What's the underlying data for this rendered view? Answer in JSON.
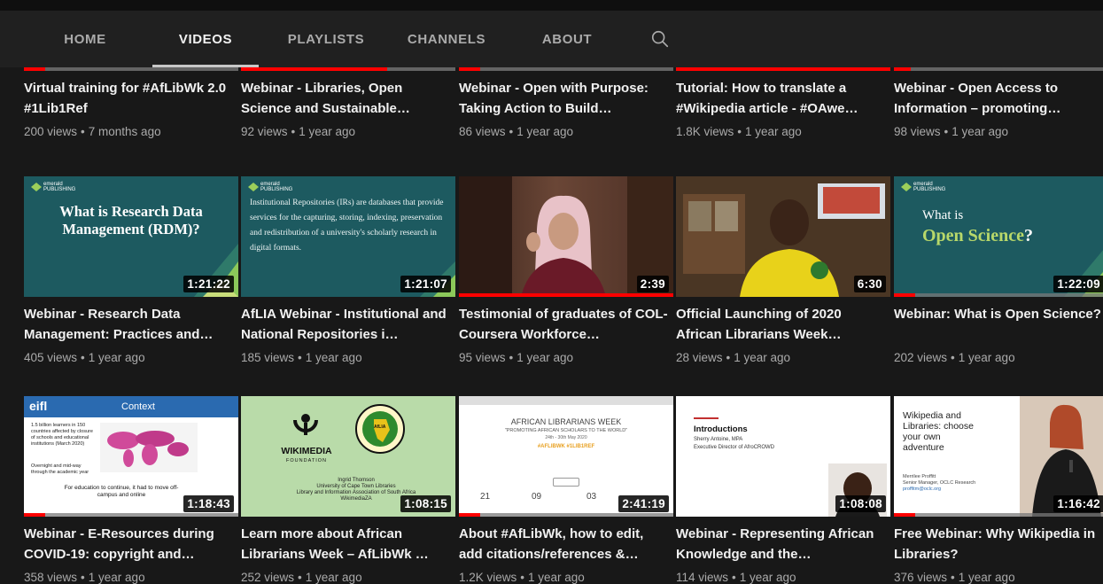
{
  "tabs": [
    {
      "label": "HOME"
    },
    {
      "label": "VIDEOS"
    },
    {
      "label": "PLAYLISTS"
    },
    {
      "label": "CHANNELS"
    },
    {
      "label": "ABOUT"
    }
  ],
  "search_icon": "search-icon",
  "colors": {
    "background": "#181818",
    "tab_bar": "#202020",
    "progress": "#ff0000",
    "emerald_teal": "#1d5a60"
  },
  "videos": [
    {
      "title": "Virtual training for #AfLibWk 2.0 #1Lib1Ref",
      "views": "200 views",
      "age": "7 months ago",
      "progress": 0.1
    },
    {
      "title": "Webinar - Libraries, Open Science and Sustainable…",
      "views": "92 views",
      "age": "1 year ago",
      "progress": 0.68
    },
    {
      "title": "Webinar - Open with Purpose: Taking Action to Build…",
      "views": "86 views",
      "age": "1 year ago",
      "progress": 0.1
    },
    {
      "title": "Tutorial: How to translate a #Wikipedia article - #OAwe…",
      "views": "1.8K views",
      "age": "1 year ago",
      "progress": 1.0
    },
    {
      "title": "Webinar - Open Access to Information – promoting…",
      "views": "98 views",
      "age": "1 year ago",
      "progress": 0.08
    },
    {
      "title": "Webinar - Research Data Management: Practices and…",
      "views": "405 views",
      "age": "1 year ago",
      "duration": "1:21:22",
      "progress": 0.0,
      "thumb": {
        "logo": "emerald PUBLISHING",
        "headline": "What is Research Data Management (RDM)?"
      }
    },
    {
      "title": "AfLIA Webinar - Institutional and National Repositories i…",
      "views": "185 views",
      "age": "1 year ago",
      "duration": "1:21:07",
      "progress": 0.0,
      "thumb": {
        "logo": "emerald PUBLISHING",
        "text": "Institutional Repositories (IRs) are databases that provide services for the capturing, storing, indexing, preservation and redistribution of a university's scholarly research in digital formats."
      }
    },
    {
      "title": "Testimonial of graduates of COL-Coursera Workforce…",
      "views": "95 views",
      "age": "1 year ago",
      "duration": "2:39",
      "progress": 1.0
    },
    {
      "title": "Official Launching of 2020 African Librarians Week…",
      "views": "28 views",
      "age": "1 year ago",
      "duration": "6:30",
      "progress": 0.0
    },
    {
      "title": "Webinar: What is Open Science?",
      "views": "202 views",
      "age": "1 year ago",
      "duration": "1:22:09",
      "progress": 0.1,
      "thumb": {
        "logo": "emerald PUBLISHING",
        "line1": "What is",
        "line2": "Open Science",
        "q": "?"
      }
    },
    {
      "title": "Webinar - E-Resources during COVID-19: copyright and…",
      "views": "358 views",
      "age": "1 year ago",
      "duration": "1:18:43",
      "progress": 0.1,
      "thumb": {
        "logo": "eifl",
        "heading": "Context",
        "bullets": [
          "1.5 billion learners in 150 countries affected by closure of schools and educational institutions (March 2020)",
          "Overnight and mid-way through the academic year"
        ],
        "caption": "For education to continue, it had to move off-campus and online"
      }
    },
    {
      "title": "Learn more about African Librarians Week – AfLibWk …",
      "views": "252 views",
      "age": "1 year ago",
      "duration": "1:08:15",
      "progress": 0.0,
      "thumb": {
        "brand": "WIKIMEDIA",
        "brand_sub": "FOUNDATION",
        "badge": "AfLIA",
        "person": "Ingrid Thomson",
        "affil1": "University of Cape Town Libraries",
        "affil2": "Library and Information Association of South Africa",
        "affil3": "WikimediaZA"
      }
    },
    {
      "title": "About #AfLibWk, how to edit, add citations/references &…",
      "views": "1.2K views",
      "age": "1 year ago",
      "duration": "2:41:19",
      "progress": 0.1,
      "thumb": {
        "heading": "AFRICAN LIBRARIANS WEEK",
        "tagline": "\"PROMOTING AFRICAN SCHOLARS TO THE WORLD\"",
        "date": "24th - 30th May 2020",
        "highlight": "#AFLIBWK #1LIB1REF",
        "counts": [
          "21",
          "09",
          "03"
        ]
      }
    },
    {
      "title": "Webinar - Representing African Knowledge and the…",
      "views": "114 views",
      "age": "1 year ago",
      "duration": "1:08:08",
      "progress": 0.0,
      "thumb": {
        "heading": "Introductions",
        "name": "Sherry Antoine, MPA",
        "role": "Executive Director of AfroCROWD"
      }
    },
    {
      "title": "Free Webinar: Why Wikipedia in Libraries?",
      "views": "376 views",
      "age": "1 year ago",
      "duration": "1:16:42",
      "progress": 0.1,
      "thumb": {
        "text": "Wikipedia and Libraries: choose your own adventure",
        "name": "Merrilee Proffitt",
        "role": "Senior Manager, OCLC Research",
        "email": "proffitm@oclc.org"
      }
    }
  ]
}
